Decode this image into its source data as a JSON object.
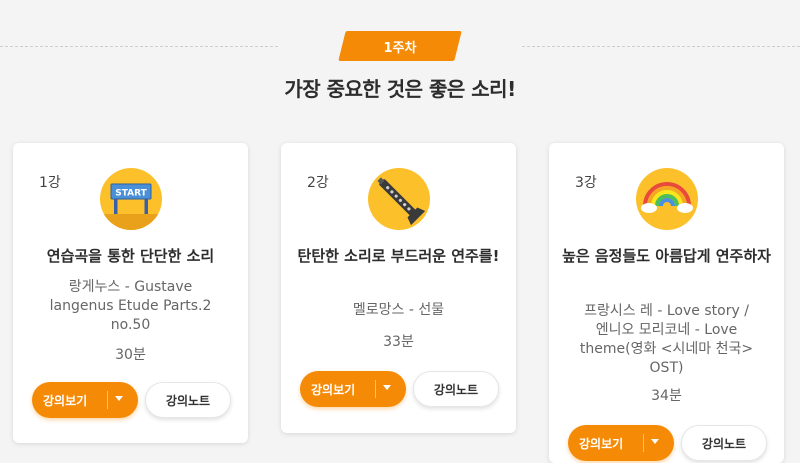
{
  "week": {
    "badge": "1주차",
    "headline": "가장 중요한 것은 좋은 소리!"
  },
  "colors": {
    "accent": "#f58a07",
    "icon_bg": "#fcc02a",
    "page_bg": "#f4f4f4"
  },
  "lessons": [
    {
      "number": "1강",
      "icon": "start-banner-icon",
      "title": "연습곡을 통한 단단한 소리",
      "description": "랑게누스 - Gustave langenus Etude Parts.2 no.50",
      "duration": "30분",
      "watch_label": "강의보기",
      "note_label": "강의노트"
    },
    {
      "number": "2강",
      "icon": "clarinet-icon",
      "title": "탄탄한 소리로 부드러운 연주를!",
      "description": "멜로망스 - 선물",
      "duration": "33분",
      "watch_label": "강의보기",
      "note_label": "강의노트"
    },
    {
      "number": "3강",
      "icon": "rainbow-icon",
      "title": "높은 음정들도 아름답게 연주하자",
      "description": "프랑시스 레 - Love story / 엔니오 모리코네 - Love theme(영화 <시네마 천국> OST)",
      "duration": "34분",
      "watch_label": "강의보기",
      "note_label": "강의노트"
    }
  ]
}
